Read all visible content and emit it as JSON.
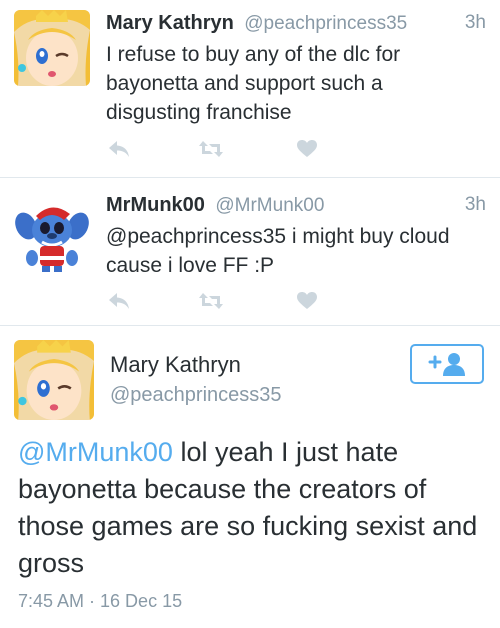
{
  "tweets": [
    {
      "name": "Mary Kathryn",
      "handle": "@peachprincess35",
      "time": "3h",
      "text": "I refuse to buy any of the dlc for bayonetta and support such a disgusting franchise"
    },
    {
      "name": "MrMunk00",
      "handle": "@MrMunk00",
      "time": "3h",
      "text": "@peachprincess35 i might buy cloud cause i love FF :P"
    }
  ],
  "detail": {
    "name": "Mary Kathryn",
    "handle": "@peachprincess35",
    "mention": "@MrMunk00",
    "text": " lol yeah I just hate bayonetta because the creators of those games are so fucking sexist and gross",
    "timestamp": "7:45 AM · 16 Dec 15"
  },
  "icons": {
    "reply": "reply-icon",
    "retweet": "retweet-icon",
    "favorite": "heart-icon",
    "follow": "follow-icon"
  },
  "colors": {
    "accent": "#55acee",
    "icon_gray": "#ccd6dd",
    "meta_gray": "#8899a6"
  }
}
